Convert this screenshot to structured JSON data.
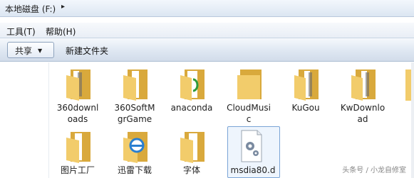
{
  "address": {
    "path": "本地磁盘 (F:)",
    "separator": "▸"
  },
  "menu": {
    "tools": "工具(T)",
    "help": "帮助(H)"
  },
  "toolbar": {
    "share": "共享",
    "new_folder": "新建文件夹"
  },
  "items": [
    {
      "name_line1": "360downl",
      "name_line2": "oads",
      "type": "folder-docs"
    },
    {
      "name_line1": "360SoftM",
      "name_line2": "grGame",
      "type": "folder-docs"
    },
    {
      "name_line1": "anaconda",
      "name_line2": "",
      "type": "folder-green"
    },
    {
      "name_line1": "CloudMusi",
      "name_line2": "c",
      "type": "folder"
    },
    {
      "name_line1": "KuGou",
      "name_line2": "",
      "type": "folder-docs"
    },
    {
      "name_line1": "KwDownlo",
      "name_line2": "ad",
      "type": "folder-docs"
    },
    {
      "name_line1": "图片工厂",
      "name_line2": "",
      "type": "folder-docs"
    },
    {
      "name_line1": "迅雷下载",
      "name_line2": "",
      "type": "folder-ie"
    },
    {
      "name_line1": "字体",
      "name_line2": "",
      "type": "folder-doc"
    },
    {
      "name_line1": "msdia80.d",
      "name_line2": "",
      "type": "dll-file",
      "selected": true
    }
  ],
  "watermark": "头条号 / 小龙自修室",
  "colors": {
    "folder": "#f2cc6b",
    "folder_dark": "#d9a93c",
    "selection": "#7aa4d6"
  }
}
